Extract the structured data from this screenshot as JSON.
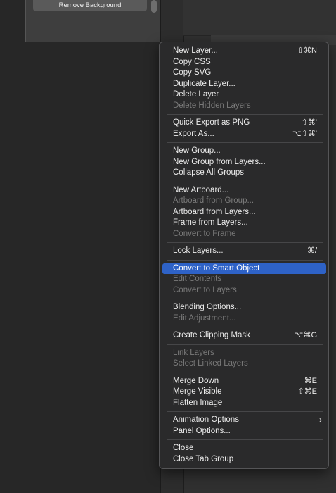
{
  "top_panel": {
    "button_label": "Remove Background"
  },
  "menu": {
    "groups": [
      [
        {
          "label": "New Layer...",
          "shortcut": "⇧⌘N",
          "enabled": true
        },
        {
          "label": "Copy CSS",
          "shortcut": "",
          "enabled": true
        },
        {
          "label": "Copy SVG",
          "shortcut": "",
          "enabled": true
        },
        {
          "label": "Duplicate Layer...",
          "shortcut": "",
          "enabled": true
        },
        {
          "label": "Delete Layer",
          "shortcut": "",
          "enabled": true
        },
        {
          "label": "Delete Hidden Layers",
          "shortcut": "",
          "enabled": false
        }
      ],
      [
        {
          "label": "Quick Export as PNG",
          "shortcut": "⇧⌘'",
          "enabled": true
        },
        {
          "label": "Export As...",
          "shortcut": "⌥⇧⌘'",
          "enabled": true
        }
      ],
      [
        {
          "label": "New Group...",
          "shortcut": "",
          "enabled": true
        },
        {
          "label": "New Group from Layers...",
          "shortcut": "",
          "enabled": true
        },
        {
          "label": "Collapse All Groups",
          "shortcut": "",
          "enabled": true
        }
      ],
      [
        {
          "label": "New Artboard...",
          "shortcut": "",
          "enabled": true
        },
        {
          "label": "Artboard from Group...",
          "shortcut": "",
          "enabled": false
        },
        {
          "label": "Artboard from Layers...",
          "shortcut": "",
          "enabled": true
        },
        {
          "label": "Frame from Layers...",
          "shortcut": "",
          "enabled": true
        },
        {
          "label": "Convert to Frame",
          "shortcut": "",
          "enabled": false
        }
      ],
      [
        {
          "label": "Lock Layers...",
          "shortcut": "⌘/",
          "enabled": true
        }
      ],
      [
        {
          "label": "Convert to Smart Object",
          "shortcut": "",
          "enabled": true,
          "highlighted": true
        },
        {
          "label": "Edit Contents",
          "shortcut": "",
          "enabled": false
        },
        {
          "label": "Convert to Layers",
          "shortcut": "",
          "enabled": false
        }
      ],
      [
        {
          "label": "Blending Options...",
          "shortcut": "",
          "enabled": true
        },
        {
          "label": "Edit Adjustment...",
          "shortcut": "",
          "enabled": false
        }
      ],
      [
        {
          "label": "Create Clipping Mask",
          "shortcut": "⌥⌘G",
          "enabled": true
        }
      ],
      [
        {
          "label": "Link Layers",
          "shortcut": "",
          "enabled": false
        },
        {
          "label": "Select Linked Layers",
          "shortcut": "",
          "enabled": false
        }
      ],
      [
        {
          "label": "Merge Down",
          "shortcut": "⌘E",
          "enabled": true
        },
        {
          "label": "Merge Visible",
          "shortcut": "⇧⌘E",
          "enabled": true
        },
        {
          "label": "Flatten Image",
          "shortcut": "",
          "enabled": true
        }
      ],
      [
        {
          "label": "Animation Options",
          "shortcut": "",
          "enabled": true,
          "submenu": true
        },
        {
          "label": "Panel Options...",
          "shortcut": "",
          "enabled": true
        }
      ],
      [
        {
          "label": "Close",
          "shortcut": "",
          "enabled": true
        },
        {
          "label": "Close Tab Group",
          "shortcut": "",
          "enabled": true
        }
      ]
    ]
  },
  "colors": {
    "highlight": "#2e62c7",
    "menu_bg": "#2a2a2b",
    "disabled_text": "#7a7a7a"
  },
  "icons": {
    "submenu_arrow": "chevron-right-icon"
  }
}
